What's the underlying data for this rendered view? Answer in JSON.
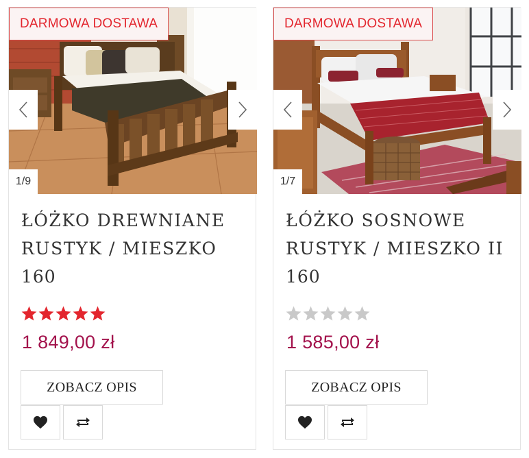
{
  "products": [
    {
      "badge": "DARMOWA DOSTAWA",
      "counter": "1/9",
      "title_line1": "ŁÓŻKO DREWNIANE",
      "title_line2": "RUSTYK / MIESZKO",
      "title_line3": "160",
      "rating": 5,
      "rating_max": 5,
      "price": "1 849,00 zł",
      "desc_button": "ZOBACZ OPIS",
      "wishlist_icon": "heart-icon",
      "compare_icon": "compare-arrows-icon"
    },
    {
      "badge": "DARMOWA DOSTAWA",
      "counter": "1/7",
      "title_line1": "ŁÓŻKO SOSNOWE",
      "title_line2": "RUSTYK / MIESZKO II",
      "title_line3": "160",
      "rating": 0,
      "rating_max": 5,
      "price": "1 585,00 zł",
      "desc_button": "ZOBACZ OPIS",
      "wishlist_icon": "heart-icon",
      "compare_icon": "compare-arrows-icon"
    }
  ],
  "colors": {
    "badge_text": "#e3262e",
    "badge_border": "#d94848",
    "price": "#a3124c",
    "star_filled": "#e3262e",
    "star_empty": "#c9c9c9"
  }
}
